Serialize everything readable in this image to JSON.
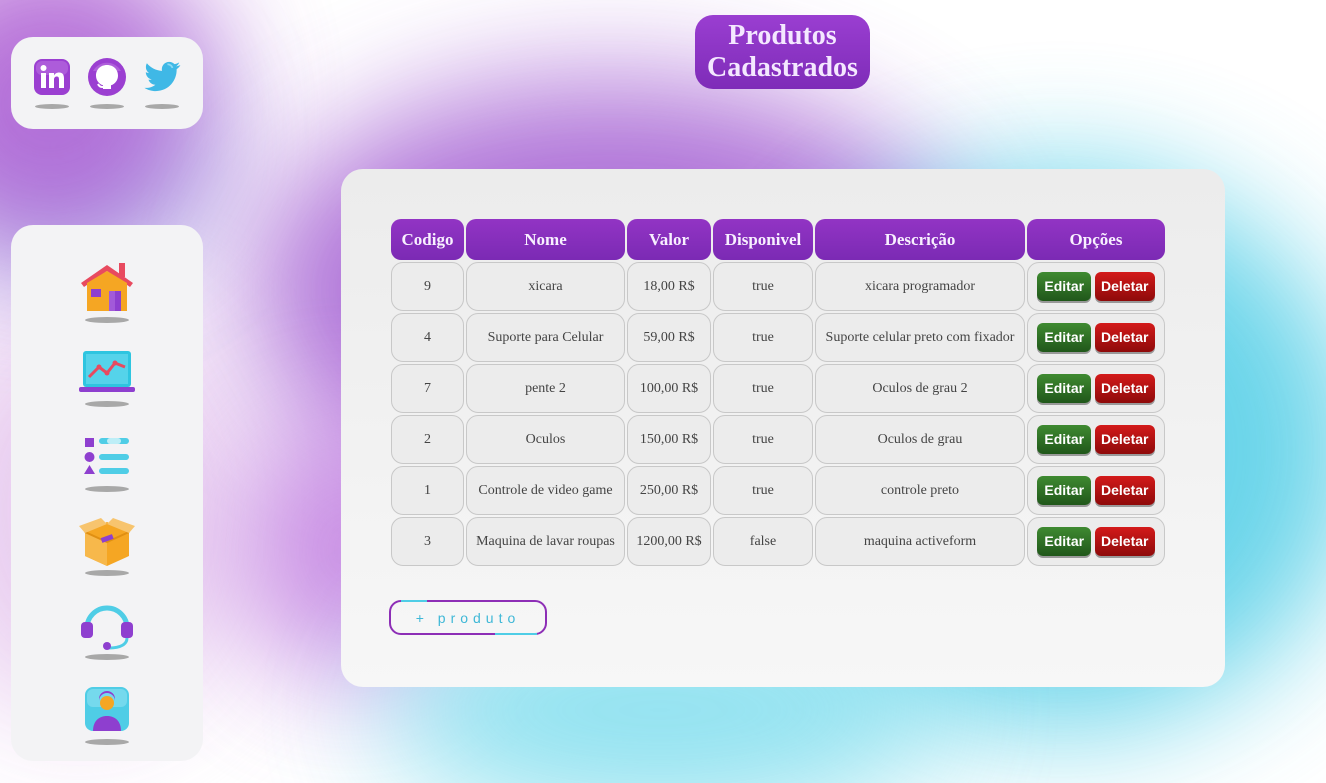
{
  "header": {
    "title_line1": "Produtos",
    "title_line2": "Cadastrados"
  },
  "social": {
    "items": [
      {
        "name": "linkedin-icon",
        "color": "#9b3fd1"
      },
      {
        "name": "github-icon",
        "color": "#9b3fd1"
      },
      {
        "name": "twitter-icon",
        "color": "#3fb8e6"
      }
    ]
  },
  "sidebar": {
    "items": [
      {
        "icon": "home-icon"
      },
      {
        "icon": "dashboard-chart-icon"
      },
      {
        "icon": "list-icon"
      },
      {
        "icon": "box-icon"
      },
      {
        "icon": "headset-support-icon"
      },
      {
        "icon": "user-profile-icon"
      }
    ]
  },
  "table": {
    "headers": [
      "Codigo",
      "Nome",
      "Valor",
      "Disponivel",
      "Descrição",
      "Opções"
    ],
    "rows": [
      {
        "codigo": "9",
        "nome": "xicara",
        "valor": "18,00 R$",
        "disponivel": "true",
        "descricao": "xicara programador"
      },
      {
        "codigo": "4",
        "nome": "Suporte para Celular",
        "valor": "59,00 R$",
        "disponivel": "true",
        "descricao": "Suporte celular preto com fixador"
      },
      {
        "codigo": "7",
        "nome": "pente 2",
        "valor": "100,00 R$",
        "disponivel": "true",
        "descricao": "Oculos de grau 2"
      },
      {
        "codigo": "2",
        "nome": "Oculos",
        "valor": "150,00 R$",
        "disponivel": "true",
        "descricao": "Oculos de grau"
      },
      {
        "codigo": "1",
        "nome": "Controle de video game",
        "valor": "250,00 R$",
        "disponivel": "true",
        "descricao": "controle preto"
      },
      {
        "codigo": "3",
        "nome": "Maquina de lavar roupas",
        "valor": "1200,00 R$",
        "disponivel": "false",
        "descricao": "maquina activeform"
      }
    ],
    "edit_label": "Editar",
    "delete_label": "Deletar"
  },
  "actions": {
    "add_product_label": "+ produto"
  },
  "colors": {
    "accent_purple": "#8a32c2",
    "accent_cyan": "#4fcde6",
    "edit_green": "#2f7026",
    "delete_red": "#b01212"
  }
}
